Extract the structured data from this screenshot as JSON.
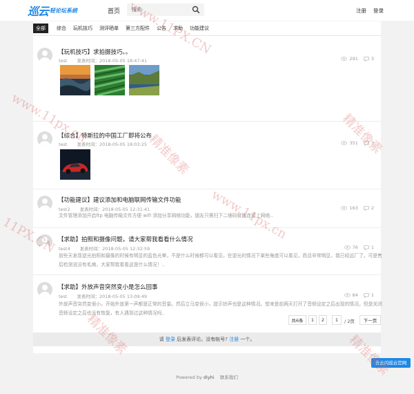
{
  "header": {
    "logo_big": "巡云",
    "logo_small": "轻论坛系统",
    "nav_home": "首页",
    "search_placeholder": "搜索",
    "register": "注册",
    "login": "登录"
  },
  "tabs": [
    "全部",
    "综合",
    "玩机技巧",
    "测评晒单",
    "第三方配件",
    "公告",
    "求助",
    "功能建议"
  ],
  "posts": [
    {
      "title": "【玩机技巧】求拍摄技巧。。",
      "user": "test",
      "time_label": "发表时间：",
      "time": "2018-05-05 18:47:41",
      "views": "291",
      "comments": "3",
      "excerpt": "",
      "images": [
        "sunset-landscape",
        "green-leaves",
        "coastal-scenery"
      ]
    },
    {
      "title": "【综合】特斯拉的中国工厂即将公布",
      "user": "test",
      "time_label": "发表时间：",
      "time": "2018-05-05 18:03:25",
      "views": "351",
      "comments": "3",
      "excerpt": "",
      "images": [
        "red-sports-car"
      ]
    },
    {
      "title": "【功能建议】建议添加和电脑联网传输文件功能",
      "user": "test2",
      "time_label": "发表时间：",
      "time": "2018-05-05 12:31:41",
      "views": "163",
      "comments": "2",
      "excerpt": "文件管理添加开启ftp 电脑传输文件方便 wifi 添加分享网络功能，朋友只需扫下二维码就能连接上网络..",
      "images": []
    },
    {
      "title": "【求助】拍照和摄像问题，请大家帮我看看什么情况",
      "user": "test4",
      "time_label": "发表时间：",
      "time": "2018-05-05 12:32:59",
      "views": "76",
      "comments": "1",
      "excerpt": "前些天发现逆光拍照和摄像的时候有明显的蓝色光晕，不是什么时候都可以看见，在逆光的情况下某些角度可以看见，而且非常明显，我已经远厂了，可是售后检测说没有毛病，大家帮我看看这是什么情况！..",
      "images": []
    },
    {
      "title": "【求助】外放声音突然变小是怎么回事",
      "user": "test",
      "time_label": "发表时间：",
      "time": "2018-05-05 13:09:49",
      "views": "84",
      "comments": "1",
      "excerpt": "外放声音突然变很小。开始外放第一声都是正常的音量。然后立马变很小，提示铃声也是这种情况。想来是前两天打开了音频设定之后出现的情况，但是关闭音频设定之后也没有恢复，有人遇到过这种情况吗..",
      "images": []
    }
  ],
  "pagination": {
    "total": "共6条",
    "page1": "1",
    "page2": "2",
    "current": "1",
    "of_pages": "/ 2页",
    "next": "下一页"
  },
  "comment_bar": {
    "prefix": "请",
    "login": "登录",
    "middle": "后发表评论。没有帐号?",
    "register": "注册",
    "suffix": "一个。"
  },
  "footer": {
    "powered": "Powered by",
    "brand": "diyhi",
    "contact": "联系我们"
  },
  "corner_button": "去云闪巡云官网",
  "watermarks": [
    "www.11PX.CN",
    "精准像素",
    "www.11px.cn",
    "精准像素",
    "www.11px.cn",
    "11PX.CN",
    "精准像素",
    "精准像素"
  ],
  "colors": {
    "accent": "#1e88e5",
    "background": "#f2f2f2"
  }
}
